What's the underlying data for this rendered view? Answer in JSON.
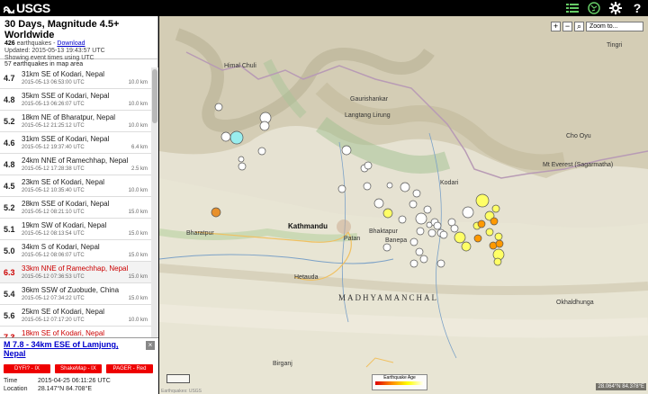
{
  "brand": {
    "logo_text": "USGS"
  },
  "toolbar": {
    "list_icon": "list-icon",
    "settings_icon": "gear-icon",
    "help_label": "?"
  },
  "summary": {
    "title": "30 Days, Magnitude 4.5+ Worldwide",
    "count": "426",
    "count_suffix": "earthquakes -",
    "download_label": "Download",
    "updated": "Updated: 2015-05-13 19:43:57 UTC",
    "timezone_note": "Showing event times using UTC",
    "in_map": "57 earthquakes in map area"
  },
  "earthquakes": [
    {
      "mag": "4.7",
      "place": "31km SE of Kodari, Nepal",
      "time": "2015-05-13 06:53:00 UTC",
      "depth": "10.0 km"
    },
    {
      "mag": "4.8",
      "place": "35km SSE of Kodari, Nepal",
      "time": "2015-05-13 06:26:07 UTC",
      "depth": "10.0 km"
    },
    {
      "mag": "5.2",
      "place": "18km NE of Bharatpur, Nepal",
      "time": "2015-05-12 21:25:12 UTC",
      "depth": "10.0 km"
    },
    {
      "mag": "4.6",
      "place": "31km SSE of Kodari, Nepal",
      "time": "2015-05-12 19:37:40 UTC",
      "depth": "6.4 km"
    },
    {
      "mag": "4.8",
      "place": "24km NNE of Ramechhap, Nepal",
      "time": "2015-05-12 17:28:38 UTC",
      "depth": "2.5 km"
    },
    {
      "mag": "4.5",
      "place": "23km SE of Kodari, Nepal",
      "time": "2015-05-12 10:35:40 UTC",
      "depth": "10.0 km"
    },
    {
      "mag": "5.2",
      "place": "28km SSE of Kodari, Nepal",
      "time": "2015-05-12 08:21:10 UTC",
      "depth": "15.0 km"
    },
    {
      "mag": "5.1",
      "place": "19km SW of Kodari, Nepal",
      "time": "2015-05-12 08:13:54 UTC",
      "depth": "15.0 km"
    },
    {
      "mag": "5.0",
      "place": "34km S of Kodari, Nepal",
      "time": "2015-05-12 08:06:07 UTC",
      "depth": "15.0 km"
    },
    {
      "mag": "6.3",
      "place": "33km NNE of Ramechhap, Nepal",
      "time": "2015-05-12 07:36:53 UTC",
      "depth": "15.0 km",
      "red": true
    },
    {
      "mag": "5.4",
      "place": "36km SSW of Zuobude, China",
      "time": "2015-05-12 07:34:22 UTC",
      "depth": "15.0 km"
    },
    {
      "mag": "5.6",
      "place": "25km SE of Kodari, Nepal",
      "time": "2015-05-12 07:17:20 UTC",
      "depth": "10.0 km"
    },
    {
      "mag": "7.3",
      "place": "18km SE of Kodari, Nepal",
      "time": "2015-05-12 07:05:19 UTC",
      "depth": "15.0 km",
      "red": true
    }
  ],
  "details": {
    "title": "M 7.8 - 34km ESE of Lamjung, Nepal",
    "buttons": [
      "DYFI? - IX",
      "ShakeMap - IX",
      "PAGER - Red"
    ],
    "time_label": "Time",
    "time_value": "2015-04-25 06:11:26 UTC",
    "location_label": "Location",
    "location_value": "28.147°N 84.708°E"
  },
  "map": {
    "zoom_label": "Zoom to...",
    "region_label": "MADHYAMANCHAL",
    "places": {
      "kathmandu": "Kathmandu",
      "patan": "Patan",
      "bhaktapur": "Bhaktapur",
      "banepa": "Banepa",
      "bharatpur": "Bharatpur",
      "hetauda": "Hetauda",
      "birganj": "Birganj",
      "kodari": "Kodari",
      "tingri": "Tingri",
      "okhaldhunga": "Okhaldhunga",
      "himal_chuli": "Himal Chuli",
      "langtang": "Langtang Lirung",
      "gaurishankar": "Gaurishankar",
      "everest": "Mt Everest (Sagarmatha)",
      "cho_oyu": "Cho Oyu"
    },
    "legend_title": "Earthquake Age",
    "coords": "28.064°N 84.378°E",
    "attrib": "Earthquakes: USGS"
  }
}
